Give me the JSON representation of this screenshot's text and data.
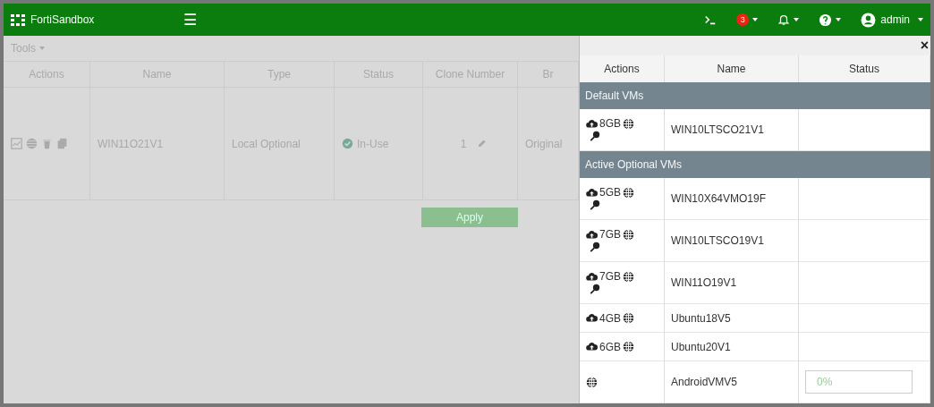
{
  "header": {
    "brand": "FortiSandbox",
    "menu_icon": "☰",
    "notifications": "3",
    "user": "admin"
  },
  "toolbar": {
    "tools": "Tools"
  },
  "table": {
    "columns": [
      "Actions",
      "Name",
      "Type",
      "Status",
      "Clone Number",
      "Br"
    ],
    "rows": [
      {
        "name": "WIN11O21V1",
        "type": "Local Optional",
        "status": "In-Use",
        "clone": "1",
        "column_6": "Original"
      }
    ]
  },
  "apply": "Apply",
  "panel": {
    "close": "×",
    "columns": [
      "Actions",
      "Name",
      "Status"
    ],
    "groups": [
      {
        "title": "Default VMs",
        "rows": [
          {
            "size": "8GB",
            "cloud": true,
            "key": true,
            "name": "WIN10LTSCO21V1"
          }
        ]
      },
      {
        "title": "Active Optional VMs",
        "rows": [
          {
            "size": "5GB",
            "cloud": true,
            "key": true,
            "name": "WIN10X64VMO19F"
          },
          {
            "size": "7GB",
            "cloud": true,
            "key": true,
            "name": "WIN10LTSCO19V1"
          },
          {
            "size": "7GB",
            "cloud": true,
            "key": true,
            "name": "WIN11O19V1"
          },
          {
            "size": "4GB",
            "cloud": true,
            "key": false,
            "name": "Ubuntu18V5"
          },
          {
            "size": "6GB",
            "cloud": true,
            "key": false,
            "name": "Ubuntu20V1"
          },
          {
            "cloud": false,
            "key": false,
            "name": "AndroidVMV5",
            "status": "0%"
          }
        ]
      }
    ]
  }
}
